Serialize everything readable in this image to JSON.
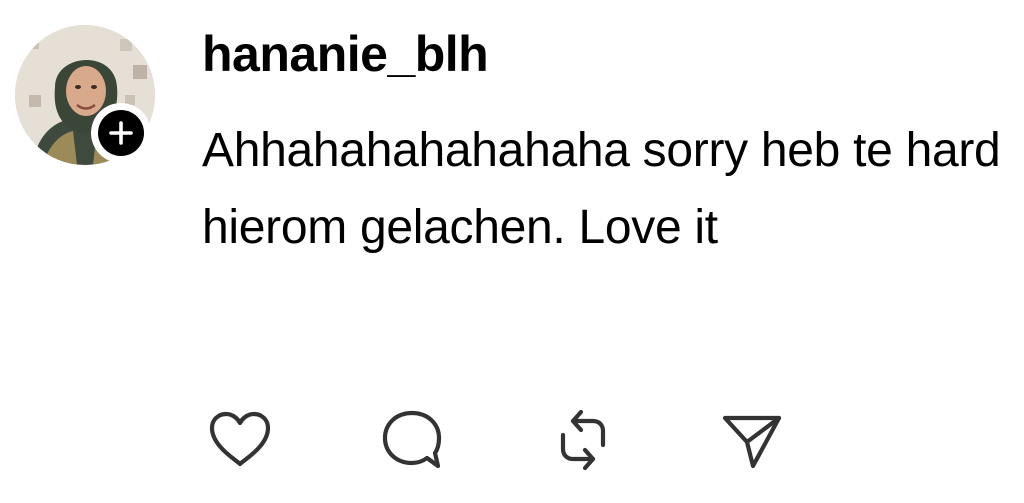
{
  "comment": {
    "username": "hananie_blh",
    "text": "Ahhahahahahahaha sorry heb te hard hierom gelachen. Love it"
  },
  "avatar": {
    "icon": "profile-photo",
    "follow_icon": "plus-icon"
  },
  "actions": [
    {
      "icon": "heart-icon",
      "label": "like"
    },
    {
      "icon": "comment-bubble-icon",
      "label": "reply"
    },
    {
      "icon": "repost-icon",
      "label": "repost"
    },
    {
      "icon": "send-icon",
      "label": "share"
    }
  ],
  "colors": {
    "text": "#000000",
    "icon_stroke": "#333333",
    "background": "#ffffff"
  }
}
